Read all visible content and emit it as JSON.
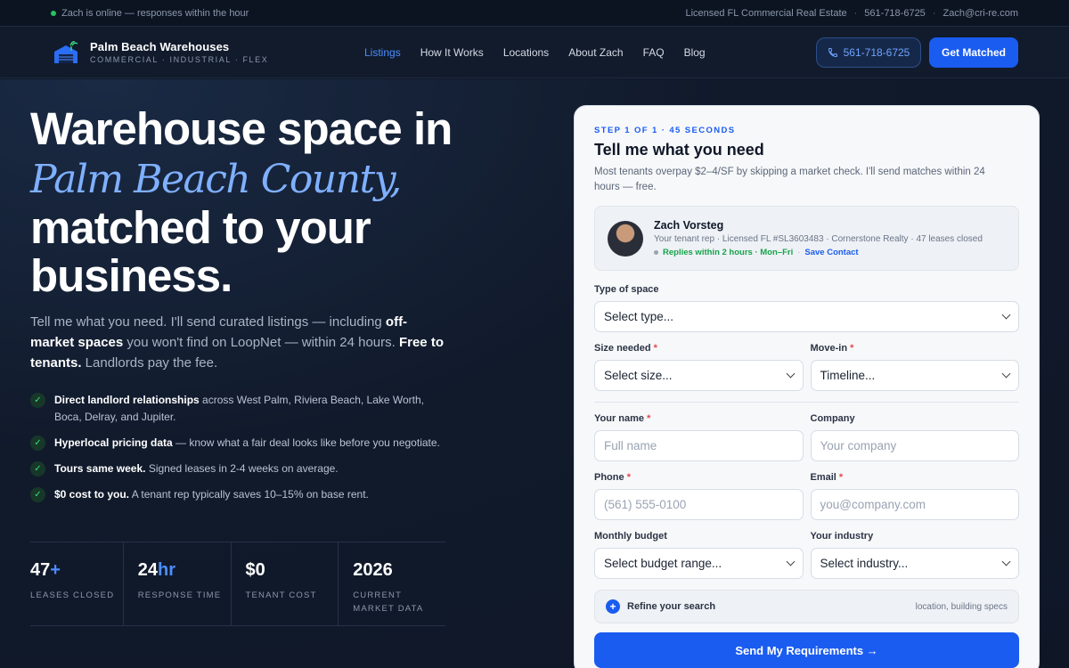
{
  "topbar": {
    "status": "Zach is online — responses within the hour",
    "license": "Licensed FL Commercial Real Estate",
    "phone": "561-718-6725",
    "email": "Zach@cri-re.com"
  },
  "brand": {
    "name": "Palm Beach Warehouses",
    "tagline": "COMMERCIAL · INDUSTRIAL · FLEX"
  },
  "nav": {
    "items": [
      {
        "label": "Listings",
        "active": true
      },
      {
        "label": "How It Works"
      },
      {
        "label": "Locations"
      },
      {
        "label": "About Zach"
      },
      {
        "label": "FAQ"
      },
      {
        "label": "Blog"
      }
    ],
    "phone_label": "561-718-6725",
    "cta_label": "Get Matched"
  },
  "hero": {
    "line1": "Warehouse space in",
    "line2": "Palm Beach County,",
    "line3": "matched to your",
    "line4": "business.",
    "lead_1": "Tell me what you need. I'll send curated listings — including ",
    "lead_bold_1": "off-market spaces",
    "lead_2": " you won't find on LoopNet — within 24 hours. ",
    "lead_bold_2": "Free to tenants.",
    "lead_3": " Landlords pay the fee.",
    "checks": [
      {
        "bold": "Direct landlord relationships",
        "text": " across West Palm, Riviera Beach, Lake Worth, Boca, Delray, and Jupiter."
      },
      {
        "bold": "Hyperlocal pricing data",
        "text": " — know what a fair deal looks like before you negotiate."
      },
      {
        "bold": "Tours same week.",
        "text": " Signed leases in 2-4 weeks on average."
      },
      {
        "bold": "$0 cost to you.",
        "text": " A tenant rep typically saves 10–15% on base rent."
      }
    ],
    "stats": [
      {
        "value": "47",
        "suffix": "+",
        "label": "LEASES CLOSED"
      },
      {
        "value": "24",
        "suffix": "hr",
        "label": "RESPONSE TIME"
      },
      {
        "value": "$0",
        "suffix": "",
        "label": "TENANT COST"
      },
      {
        "value": "2026",
        "suffix": "",
        "label": "CURRENT MARKET DATA"
      }
    ]
  },
  "form": {
    "step": "STEP 1 OF 1 · 45 SECONDS",
    "title": "Tell me what you need",
    "subtitle": "Most tenants overpay $2–4/SF by skipping a market check. I'll send matches within 24 hours — free.",
    "rep": {
      "name": "Zach Vorsteg",
      "details": "Your tenant rep · Licensed FL #SL3603483 · Cornerstone Realty · 47 leases closed",
      "replies": "Replies within 2 hours · Mon–Fri",
      "save": "Save Contact"
    },
    "type_label": "Type of space",
    "type_value": "Select type...",
    "size_label": "Size needed",
    "size_value": "Select size...",
    "movein_label": "Move-in",
    "movein_value": "Timeline...",
    "name_label": "Your name",
    "name_placeholder": "Full name",
    "company_label": "Company",
    "company_placeholder": "Your company",
    "phone_label": "Phone",
    "phone_placeholder": "(561) 555-0100",
    "email_label": "Email",
    "email_placeholder": "you@company.com",
    "budget_label": "Monthly budget",
    "budget_value": "Select budget range...",
    "industry_label": "Your industry",
    "industry_value": "Select industry...",
    "refine_label": "Refine your search",
    "refine_hint": "location, building specs",
    "submit_label": "Send My Requirements →"
  },
  "colors": {
    "accent": "#1a5cf0",
    "success": "#22c55e",
    "background": "#0f1828"
  }
}
